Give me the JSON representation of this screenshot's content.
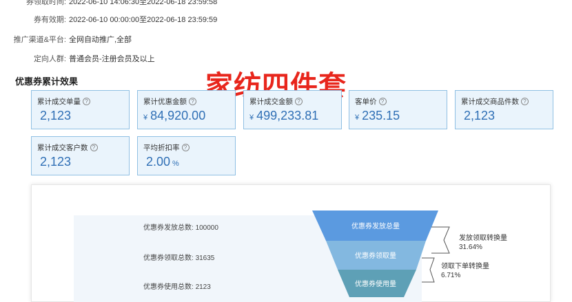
{
  "coupon_info": {
    "rows": [
      {
        "label": "券领取时间:",
        "value": "2022-06-10 14:06:30至2022-06-18 23:59:58"
      },
      {
        "label": "券有效期:",
        "value": "2022-06-10 00:00:00至2022-06-18 23:59:59"
      },
      {
        "label": "推广渠道&平台:",
        "value": "全网自动推广,全部"
      },
      {
        "label": "定向人群:",
        "value": "普通会员-注册会员及以上"
      }
    ]
  },
  "section_title": "优惠券累计效果",
  "watermark": "家纺四件套",
  "help_icon_glyph": "?",
  "cards": [
    {
      "label": "累计成交单量",
      "currency": "",
      "value": "2,123",
      "unit": ""
    },
    {
      "label": "累计优惠金额",
      "currency": "¥",
      "value": "84,920.00",
      "unit": ""
    },
    {
      "label": "累计成交金额",
      "currency": "¥",
      "value": "499,233.81",
      "unit": ""
    },
    {
      "label": "客单价",
      "currency": "¥",
      "value": "235.15",
      "unit": ""
    },
    {
      "label": "累计成交商品件数",
      "currency": "",
      "value": "2,123",
      "unit": ""
    },
    {
      "label": "累计成交客户数",
      "currency": "",
      "value": "2,123",
      "unit": ""
    },
    {
      "label": "平均折扣率",
      "currency": "",
      "value": "2.00",
      "unit": "%"
    }
  ],
  "funnel": {
    "stats": [
      {
        "label": "优惠券发放总数:",
        "value": "100000"
      },
      {
        "label": "优惠券领取总数:",
        "value": "31635"
      },
      {
        "label": "优惠券使用总数:",
        "value": "2123"
      }
    ],
    "stages": [
      "优惠券发放总量",
      "优惠券领取量",
      "优惠券使用量"
    ],
    "stage_colors": [
      "#5b9ae0",
      "#83b8e0",
      "#5ea0b6"
    ],
    "conversions": [
      {
        "label": "发放领取转换量",
        "value": "31.64%"
      },
      {
        "label": "领取下单转换量",
        "value": "6.71%"
      }
    ]
  }
}
